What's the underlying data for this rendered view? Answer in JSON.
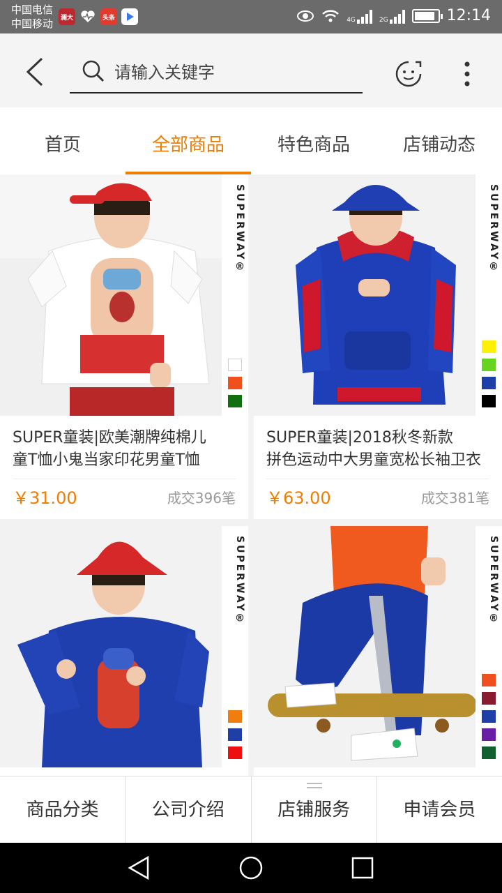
{
  "status_bar": {
    "carrier_1": "中国电信",
    "carrier_2": "中国移动",
    "app_icons": [
      "news-app-icon",
      "health-app-icon",
      "toutiao-app-icon",
      "video-app-icon"
    ],
    "app_icon_labels": [
      "澜大",
      "",
      "头条",
      ""
    ],
    "network_1": "4G",
    "network_2": "2G",
    "battery_level": 0.9,
    "time": "12:14"
  },
  "search": {
    "placeholder": "请输入关键字",
    "value": ""
  },
  "tabs": [
    {
      "label": "首页",
      "active": false
    },
    {
      "label": "全部商品",
      "active": true
    },
    {
      "label": "特色商品",
      "active": false
    },
    {
      "label": "店铺动态",
      "active": false
    }
  ],
  "products": [
    {
      "brand": "SUPERWAY®",
      "title_line1": " SUPER童装|欧美潮牌纯棉儿",
      "title_line2": "童T恤小鬼当家印花男童T恤",
      "price": "￥31.00",
      "sales": "成交396笔",
      "swatches": [
        "#ffffff",
        "#f0501e",
        "#107010"
      ]
    },
    {
      "brand": "SUPERWAY®",
      "title_line1": " SUPER童装|2018秋冬新款",
      "title_line2": "拼色运动中大男童宽松长袖卫衣",
      "price": "￥63.00",
      "sales": "成交381笔",
      "swatches": [
        "#ffef00",
        "#66d41e",
        "#1e3ea8",
        "#000000"
      ]
    },
    {
      "brand": "SUPERWAY®",
      "swatches": [
        "#f07d10",
        "#1e3ea8",
        "#ee1010"
      ]
    },
    {
      "brand": "SUPERWAY®",
      "swatches": [
        "#f0501e",
        "#8a1a30",
        "#1e3ea8",
        "#6a1ea8",
        "#106030"
      ]
    }
  ],
  "bottom_menu": [
    "商品分类",
    "公司介绍",
    "店铺服务",
    "申请会员"
  ],
  "colors": {
    "accent": "#f07d00",
    "status_bar": "#6b6b6b"
  }
}
